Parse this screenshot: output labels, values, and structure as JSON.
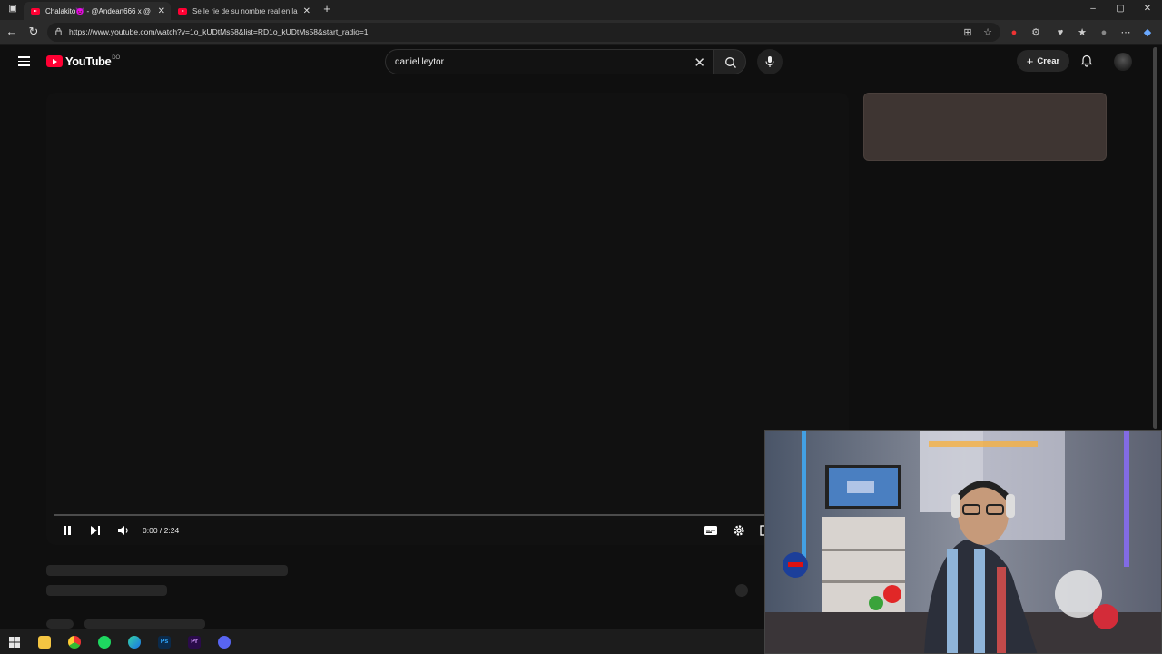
{
  "browser": {
    "tabs": [
      {
        "title": "Chalakito👿 - @Andean666 x @",
        "active": true
      },
      {
        "title": "Se le rie de su nombre real en la",
        "active": false
      }
    ],
    "url": "https://www.youtube.com/watch?v=1o_kUDtMs58&list=RD1o_kUDtMs58&start_radio=1",
    "icons": [
      "back-icon",
      "refresh-icon",
      "lock-icon",
      "new-tab-icon",
      "star-icon",
      "extensions-icon",
      "favorites-icon",
      "profile-icon",
      "menu-icon",
      "copilot-icon"
    ]
  },
  "youtube": {
    "logo_text": "YouTube",
    "country_code": "DO",
    "search": {
      "value": "daniel leytor"
    },
    "create_label": "Crear"
  },
  "player": {
    "time": "0:00 / 2:24",
    "progress": 0.0
  },
  "colors": {
    "brand": "#ff0033",
    "background": "#0f0f0f",
    "ad_placeholder": "#3e3532"
  },
  "taskbar": {
    "apps": [
      "windows-start-icon",
      "file-explorer-icon",
      "chrome-icon",
      "spotify-icon",
      "edge-icon",
      "photoshop-icon",
      "premiere-icon",
      "discord-icon"
    ],
    "app_labels": {
      "photoshop": "Ps",
      "premiere": "Pr"
    }
  }
}
